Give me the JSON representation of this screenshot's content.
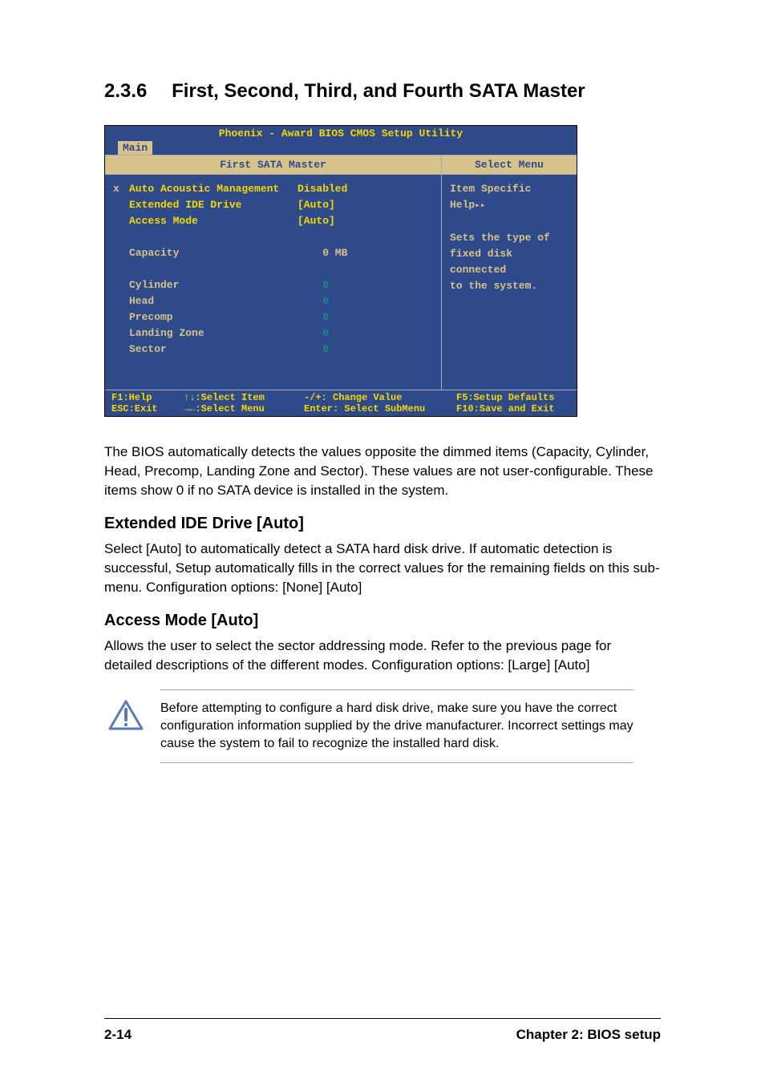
{
  "heading": {
    "number": "2.3.6",
    "title": "First, Second, Third, and Fourth SATA Master"
  },
  "bios": {
    "title": "Phoenix - Award BIOS CMOS Setup Utility",
    "tab": "Main",
    "header_left": "First SATA Master",
    "header_right": "Select Menu",
    "rows": [
      {
        "marker": "x",
        "label": "Auto Acoustic Management",
        "value": "Disabled",
        "label_class": "yellow",
        "value_class": "yellow"
      },
      {
        "marker": "",
        "label": "Extended IDE Drive",
        "value": "[Auto]",
        "label_class": "yellow",
        "value_class": "yellow"
      },
      {
        "marker": "",
        "label": "Access Mode",
        "value": "[Auto]",
        "label_class": "yellow",
        "value_class": "yellow"
      }
    ],
    "capacity_row": {
      "label": "Capacity",
      "value": "    0 MB"
    },
    "dim_rows": [
      {
        "label": "Cylinder",
        "value": "    0"
      },
      {
        "label": "Head",
        "value": "    0"
      },
      {
        "label": "Precomp",
        "value": "    0"
      },
      {
        "label": "Landing Zone",
        "value": "    0"
      },
      {
        "label": "Sector",
        "value": "    0"
      }
    ],
    "help_title": "Item Specific Help",
    "help_body_l1": "Sets the type of",
    "help_body_l2": "fixed disk connected",
    "help_body_l3": "to the system.",
    "footer": {
      "r1c1": "F1:Help",
      "r1c2": "↑↓:Select Item",
      "r1c3": "-/+: Change Value",
      "r1c4": "F5:Setup Defaults",
      "r2c1": "ESC:Exit",
      "r2c2": "→←:Select Menu",
      "r2c3": "Enter: Select SubMenu",
      "r2c4": "F10:Save and Exit"
    }
  },
  "para1": "The BIOS automatically detects the values opposite the dimmed items (Capacity, Cylinder,  Head, Precomp, Landing Zone and Sector). These values are not user-configurable. These items show 0 if no SATA device is installed in the system.",
  "sub1_title": "Extended IDE Drive [Auto]",
  "sub1_body": "Select [Auto] to automatically detect a SATA hard disk drive. If automatic detection is successful, Setup automatically fills in the correct values for the remaining fields on this sub-menu. Configuration options: [None] [Auto]",
  "sub2_title": "Access Mode [Auto]",
  "sub2_body": "Allows the user to select the sector addressing mode. Refer to the previous page for detailed descriptions of the different modes. Configuration options: [Large] [Auto]",
  "note": "Before attempting to configure a hard disk drive, make sure you have the correct configuration information supplied by the drive manufacturer. Incorrect settings may cause the system to fail to recognize the installed hard disk.",
  "footer": {
    "left": "2-14",
    "right": "Chapter 2: BIOS setup"
  }
}
